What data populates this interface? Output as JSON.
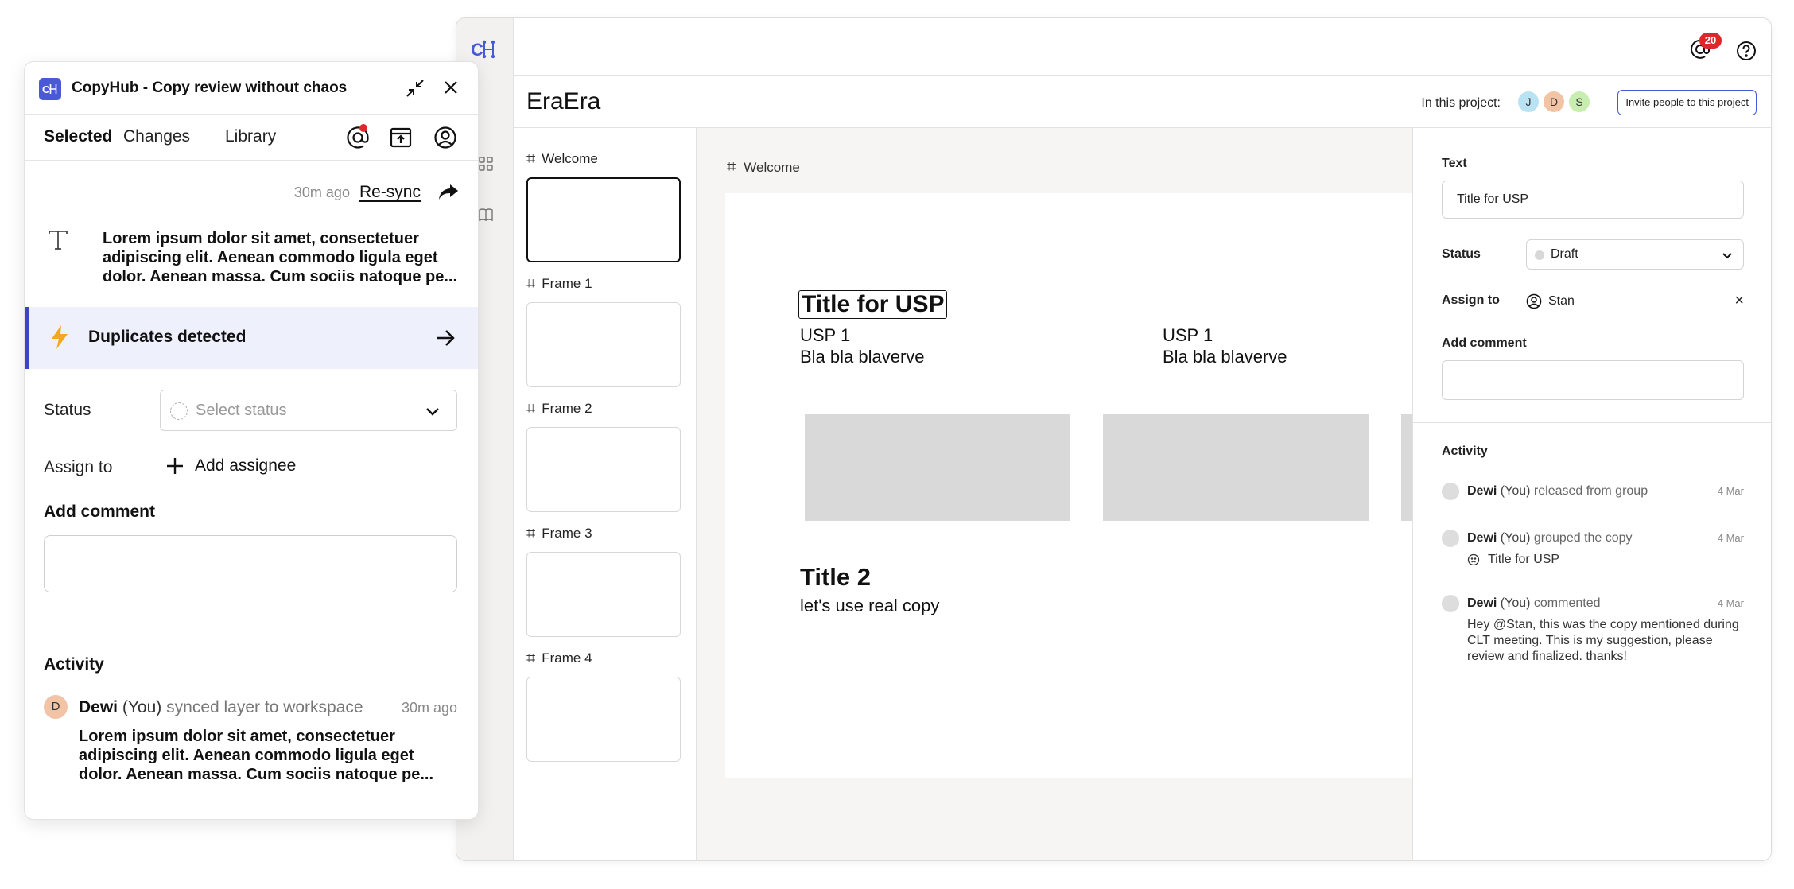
{
  "app": {
    "logo": "C→H",
    "notifications_count": "20",
    "project": {
      "title": "EraEra",
      "in_project_label": "In this project:",
      "members": [
        {
          "initial": "J",
          "color": "#b9e3f3"
        },
        {
          "initial": "D",
          "color": "#f3c3a5"
        },
        {
          "initial": "S",
          "color": "#c7eeb0"
        }
      ],
      "invite_label": "Invite people to this project"
    },
    "frames": [
      {
        "label": "Welcome",
        "selected": true
      },
      {
        "label": "Frame 1",
        "selected": false
      },
      {
        "label": "Frame 2",
        "selected": false
      },
      {
        "label": "Frame 3",
        "selected": false
      },
      {
        "label": "Frame 4",
        "selected": false
      }
    ],
    "canvas": {
      "frame_label": "Welcome",
      "title_usp": "Title for USP",
      "usp_columns": [
        {
          "heading": "USP 1",
          "body": "Bla bla blaverve"
        },
        {
          "heading": "USP 1",
          "body": "Bla bla blaverve"
        }
      ],
      "title2": "Title 2",
      "title2_sub": "let's use real copy"
    },
    "props": {
      "text_label": "Text",
      "text_value": "Title for USP",
      "status_label": "Status",
      "status_value": "Draft",
      "assign_label": "Assign to",
      "assignee": "Stan",
      "comment_label": "Add comment",
      "activity_label": "Activity",
      "activity": [
        {
          "name": "Dewi",
          "you": "(You)",
          "action": "released from group",
          "date": "4 Mar",
          "sub": ""
        },
        {
          "name": "Dewi",
          "you": "(You)",
          "action": "grouped the copy",
          "date": "4 Mar",
          "sub": "Title for USP"
        },
        {
          "name": "Dewi",
          "you": "(You)",
          "action": "commented",
          "date": "4 Mar",
          "sub": "Hey @Stan, this was the copy mentioned during CLT meeting. This is my suggestion, please review and finalized. thanks!"
        }
      ]
    }
  },
  "plugin": {
    "logo": "C→H",
    "title": "CopyHub - Copy review without chaos",
    "tabs": [
      "Selected",
      "Changes",
      "Library"
    ],
    "synced_ago": "30m ago",
    "resync_label": "Re-sync",
    "layer_text": "Lorem ipsum dolor sit amet, consectetuer adipiscing elit. Aenean commodo ligula eget dolor. Aenean massa. Cum sociis natoque pe...",
    "duplicates_label": "Duplicates detected",
    "status_label": "Status",
    "status_placeholder": "Select status",
    "assign_label": "Assign to",
    "add_assignee_label": "Add assignee",
    "comment_label": "Add comment",
    "activity_label": "Activity",
    "activity": {
      "avatar": "D",
      "name": "Dewi",
      "you": "(You)",
      "action": "synced layer to workspace",
      "ago": "30m ago",
      "body": "Lorem ipsum dolor sit amet, consectetuer adipiscing elit. Aenean commodo ligula eget dolor. Aenean massa. Cum sociis natoque pe..."
    }
  },
  "colors": {
    "accent": "#4a5ad6",
    "badge_red": "#e0262b",
    "duplicates_bg": "#eef0fc",
    "duplicates_bar": "#3b46c4",
    "canvas_bg": "#f6f5f3",
    "placeholder_gray": "#d9d9d9"
  },
  "icons": [
    "logo-icon",
    "components-icon",
    "library-book-icon",
    "mention-icon",
    "help-icon",
    "frame-hash-icon",
    "chevron-down-icon",
    "user-circle-icon",
    "close-icon",
    "minimize-icon",
    "export-icon",
    "text-type-icon",
    "share-arrow-icon",
    "lightning-icon",
    "arrow-right-icon",
    "plus-icon",
    "dashed-circle-icon",
    "smiley-icon"
  ]
}
